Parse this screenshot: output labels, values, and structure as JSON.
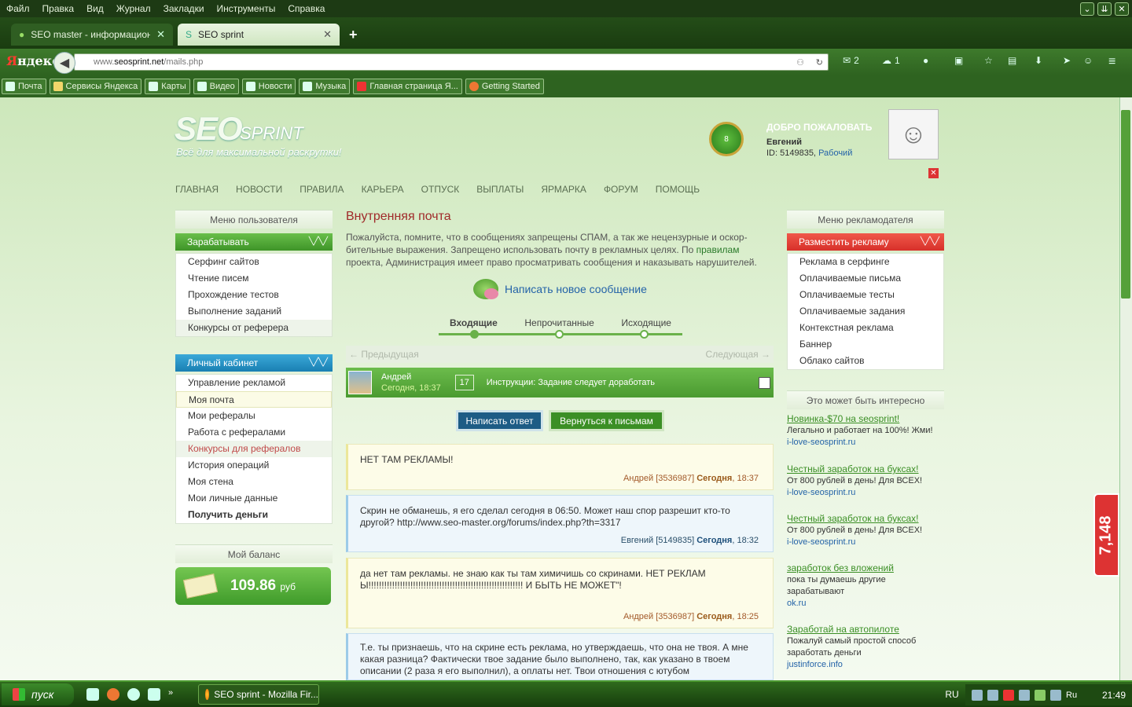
{
  "browser": {
    "menu": [
      "Файл",
      "Правка",
      "Вид",
      "Журнал",
      "Закладки",
      "Инструменты",
      "Справка"
    ],
    "tabs": [
      {
        "title": "SEO master - информационн...",
        "icon": "speech-bubbles-icon"
      },
      {
        "title": "SEO sprint",
        "icon": "seosprint-s-icon"
      }
    ],
    "new_tab": "+",
    "url_host": "www.",
    "url_domain": "seosprint.net",
    "url_path": "/mails.php",
    "logo_ya": "Я",
    "logo_rest": "ндекс",
    "mail_count": "2",
    "weather_count": "1",
    "bookmarks": [
      "Почта",
      "Сервисы Яндекса",
      "Карты",
      "Видео",
      "Новости",
      "Музыка",
      "Главная страница Я...",
      "Getting Started"
    ]
  },
  "site": {
    "logo_seo": "SEO",
    "logo_sprint": "SPRINT",
    "tagline": "Всё для максимальной раскрутки!",
    "level": "8",
    "welcome": "ДОБРО ПОЖАЛОВАТЬ",
    "username": "Евгений",
    "user_id": "ID: 5149835,",
    "user_status": "Рабочий",
    "nav": [
      "ГЛАВНАЯ",
      "НОВОСТИ",
      "ПРАВИЛА",
      "КАРЬЕРА",
      "ОТПУСК",
      "ВЫПЛАТЫ",
      "ЯРМАРКА",
      "ФОРУМ",
      "ПОМОЩЬ"
    ]
  },
  "left": {
    "user_menu_title": "Меню пользователя",
    "earn_title": "Зарабатывать",
    "earn_items": [
      "Серфинг сайтов",
      "Чтение писем",
      "Прохождение тестов",
      "Выполнение заданий",
      "Конкурсы от реферера"
    ],
    "cabinet_title": "Личный кабинет",
    "cabinet_items": [
      "Управление рекламой",
      "Моя почта",
      "Мои рефералы",
      "Работа с рефералами",
      "Конкурсы для рефералов",
      "История операций",
      "Моя стена",
      "Мои личные данные",
      "Получить деньги"
    ],
    "balance_title": "Мой баланс",
    "balance": "109.86",
    "currency": "руб"
  },
  "main": {
    "title": "Внутренняя почта",
    "notice_1": "Пожалуйста, помните, что в сообщениях запрещены СПАМ, а так же нецензурные и оскор-бительные выражения. Запрещено использовать почту в рекламных целях. По ",
    "notice_link": "правилам",
    "notice_2": " проекта, Администрация имеет право просматривать сообщения и наказывать нарушителей.",
    "new_message": "Написать новое сообщение",
    "tabs": [
      "Входящие",
      "Непрочитанные",
      "Исходящие"
    ],
    "prev": "← Предыдущая",
    "next": "Следующая →",
    "row": {
      "sender": "Андрей",
      "date": "Сегодня, 18:37",
      "number": "17",
      "subject": "Инструкции: Задание следует доработать"
    },
    "reply_button": "Написать ответ",
    "back_button": "Вернуться к письмам",
    "messages": [
      {
        "text": "НЕТ ТАМ РЕКЛАМЫ!",
        "author": "Андрей [3536987]",
        "day": "Сегодня",
        "time": ", 18:37"
      },
      {
        "text": "Скрин не обманешь, я его сделал сегодня в 06:50. Может наш спор разрешит кто-то другой? http://www.seo-master.org/forums/index.php?th=3317",
        "author": "Евгений [5149835]",
        "day": "Сегодня",
        "time": ", 18:32"
      },
      {
        "text": "да нет там рекламы. не знаю как ты там химичишь со скринами. НЕТ РЕКЛАМЫ!!!!!!!!!!!!!!!!!!!!!!!!!!!!!!!!!!!!!!!!!!!!!!!!!!!!!!!!!!! И БЫТЬ НЕ МОЖЕТ\"!",
        "author": "Андрей [3536987]",
        "day": "Сегодня",
        "time": ", 18:25"
      },
      {
        "text": "Т.е. ты признаешь, что на скрине есть реклама, но утверждаешь, что она не твоя. А мне какая разница? Фактически твое задание было выполнено, так, как указано в твоем описании (2 раза я его выполнил), а оплаты нет. Твои отношения с ютубом"
      }
    ]
  },
  "right": {
    "adv_menu_title": "Меню рекламодателя",
    "place_ad": "Разместить рекламу",
    "adv_items": [
      "Реклама в серфинге",
      "Оплачиваемые письма",
      "Оплачиваемые тесты",
      "Оплачиваемые задания",
      "Контекстная реклама",
      "Баннер",
      "Облако сайтов"
    ],
    "interest_title": "Это может быть интересно",
    "ads": [
      {
        "h": "Новинка-$70 на seosprint!",
        "t": "Легально и работает на 100%! Жми!",
        "u": "i-love-seosprint.ru"
      },
      {
        "h": "Честный заработок на буксах!",
        "t": "От 800 рублей в день! Для ВСЕХ!",
        "u": "i-love-seosprint.ru"
      },
      {
        "h": "Честный заработок на буксах!",
        "t": "От 800 рублей в день! Для ВСЕХ!",
        "u": "i-love-seosprint.ru"
      },
      {
        "h": "заработок без вложений",
        "t": "пока ты думаешь другие зарабатывают",
        "u": "ok.ru"
      },
      {
        "h": "Заработай на автопилоте",
        "t": "Пожалуй самый простой способ заработать деньги",
        "u": "justinforce.info"
      }
    ],
    "side_counter": "7,148"
  },
  "taskbar": {
    "start": "пуск",
    "task": "SEO sprint - Mozilla Fir...",
    "lang": "RU",
    "tray_lang": "Ru",
    "time": "21:49"
  }
}
